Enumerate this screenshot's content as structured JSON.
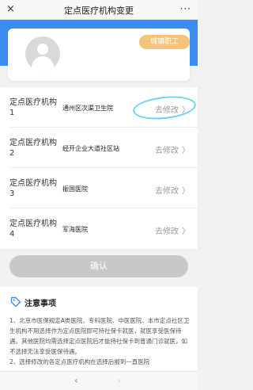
{
  "titlebar": {
    "close_icon": "×",
    "title": "定点医疗机构变更",
    "more_icon": "···"
  },
  "profile": {
    "badge": "城镇职工"
  },
  "institutions": [
    {
      "label": "定点医疗机构1",
      "value": "通州区次渠卫生院",
      "action": "去修改"
    },
    {
      "label": "定点医疗机构2",
      "value": "经开企业大道社区站",
      "action": "去修改"
    },
    {
      "label": "定点医疗机构3",
      "value": "振国医院",
      "action": "去修改"
    },
    {
      "label": "定点医疗机构4",
      "value": "军海医院",
      "action": "去修改"
    }
  ],
  "chevron": "〉",
  "confirm_label": "确认",
  "notes": {
    "title": "注意事项",
    "text": "1、北京市医保规定A类医院、专科医院、中医医院、本市定点社区卫生机构不用选择作为定点医院即可持社保卡就医，就医享受医保待遇。其他医院均需选择定点医院后才能持社保卡到普通门诊就医，如不选择无法享受医保待遇。\n2、选择修改的各定点医疗机构在选择后报到一直医院"
  },
  "nav": {
    "back_icon": "‹",
    "forward_icon": "›"
  },
  "colors": {
    "banner": "#3b8ef0",
    "badge": "#f5c47b",
    "highlight": "#6ed3f0",
    "confirm_disabled": "#c8c8c8"
  }
}
